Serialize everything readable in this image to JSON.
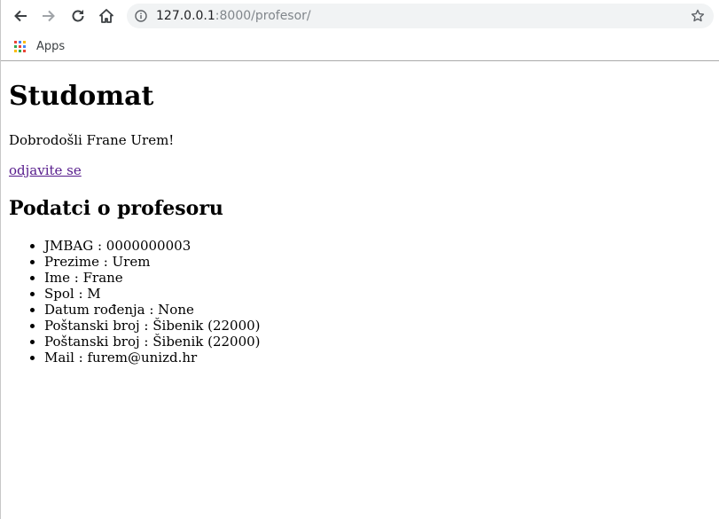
{
  "browser": {
    "url_host": "127.0.0.1",
    "url_rest": ":8000/profesor/",
    "bookmarks": [
      {
        "label": "Apps"
      }
    ]
  },
  "page": {
    "title": "Studomat",
    "welcome": "Dobrodošli Frane Urem!",
    "logout_label": "odjavite se",
    "section_title": "Podatci o profesoru",
    "details": [
      {
        "text": "JMBAG : 0000000003"
      },
      {
        "text": "Prezime : Urem"
      },
      {
        "text": "Ime : Frane"
      },
      {
        "text": "Spol : M"
      },
      {
        "text": "Datum rođenja : None"
      },
      {
        "text": "Poštanski broj : Šibenik (22000)"
      },
      {
        "text": "Poštanski broj : Šibenik (22000)"
      },
      {
        "text": "Mail : furem@unizd.hr"
      }
    ]
  },
  "icons": {
    "back": "back-arrow-icon",
    "forward": "forward-arrow-icon",
    "reload": "reload-icon",
    "home": "home-icon",
    "site_info": "info-icon",
    "bookmark": "star-icon",
    "apps": "apps-grid-icon"
  },
  "colors": {
    "link_visited": "#551a8b",
    "omnibox_bg": "#f1f3f4",
    "apps_dots": [
      "#ea4335",
      "#4285f4",
      "#fbbc05",
      "#34a853",
      "#ea4335",
      "#4285f4",
      "#fbbc05",
      "#34a853",
      "#ea4335"
    ]
  }
}
